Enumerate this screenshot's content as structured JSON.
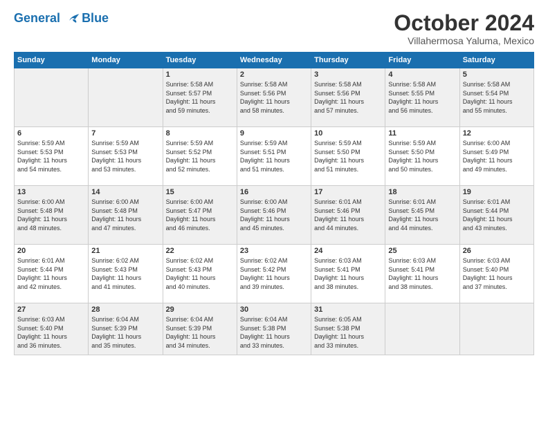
{
  "header": {
    "logo_line1": "General",
    "logo_line2": "Blue",
    "month": "October 2024",
    "location": "Villahermosa Yaluma, Mexico"
  },
  "weekdays": [
    "Sunday",
    "Monday",
    "Tuesday",
    "Wednesday",
    "Thursday",
    "Friday",
    "Saturday"
  ],
  "weeks": [
    [
      {
        "day": "",
        "info": ""
      },
      {
        "day": "",
        "info": ""
      },
      {
        "day": "1",
        "info": "Sunrise: 5:58 AM\nSunset: 5:57 PM\nDaylight: 11 hours\nand 59 minutes."
      },
      {
        "day": "2",
        "info": "Sunrise: 5:58 AM\nSunset: 5:56 PM\nDaylight: 11 hours\nand 58 minutes."
      },
      {
        "day": "3",
        "info": "Sunrise: 5:58 AM\nSunset: 5:56 PM\nDaylight: 11 hours\nand 57 minutes."
      },
      {
        "day": "4",
        "info": "Sunrise: 5:58 AM\nSunset: 5:55 PM\nDaylight: 11 hours\nand 56 minutes."
      },
      {
        "day": "5",
        "info": "Sunrise: 5:58 AM\nSunset: 5:54 PM\nDaylight: 11 hours\nand 55 minutes."
      }
    ],
    [
      {
        "day": "6",
        "info": "Sunrise: 5:59 AM\nSunset: 5:53 PM\nDaylight: 11 hours\nand 54 minutes."
      },
      {
        "day": "7",
        "info": "Sunrise: 5:59 AM\nSunset: 5:53 PM\nDaylight: 11 hours\nand 53 minutes."
      },
      {
        "day": "8",
        "info": "Sunrise: 5:59 AM\nSunset: 5:52 PM\nDaylight: 11 hours\nand 52 minutes."
      },
      {
        "day": "9",
        "info": "Sunrise: 5:59 AM\nSunset: 5:51 PM\nDaylight: 11 hours\nand 51 minutes."
      },
      {
        "day": "10",
        "info": "Sunrise: 5:59 AM\nSunset: 5:50 PM\nDaylight: 11 hours\nand 51 minutes."
      },
      {
        "day": "11",
        "info": "Sunrise: 5:59 AM\nSunset: 5:50 PM\nDaylight: 11 hours\nand 50 minutes."
      },
      {
        "day": "12",
        "info": "Sunrise: 6:00 AM\nSunset: 5:49 PM\nDaylight: 11 hours\nand 49 minutes."
      }
    ],
    [
      {
        "day": "13",
        "info": "Sunrise: 6:00 AM\nSunset: 5:48 PM\nDaylight: 11 hours\nand 48 minutes."
      },
      {
        "day": "14",
        "info": "Sunrise: 6:00 AM\nSunset: 5:48 PM\nDaylight: 11 hours\nand 47 minutes."
      },
      {
        "day": "15",
        "info": "Sunrise: 6:00 AM\nSunset: 5:47 PM\nDaylight: 11 hours\nand 46 minutes."
      },
      {
        "day": "16",
        "info": "Sunrise: 6:00 AM\nSunset: 5:46 PM\nDaylight: 11 hours\nand 45 minutes."
      },
      {
        "day": "17",
        "info": "Sunrise: 6:01 AM\nSunset: 5:46 PM\nDaylight: 11 hours\nand 44 minutes."
      },
      {
        "day": "18",
        "info": "Sunrise: 6:01 AM\nSunset: 5:45 PM\nDaylight: 11 hours\nand 44 minutes."
      },
      {
        "day": "19",
        "info": "Sunrise: 6:01 AM\nSunset: 5:44 PM\nDaylight: 11 hours\nand 43 minutes."
      }
    ],
    [
      {
        "day": "20",
        "info": "Sunrise: 6:01 AM\nSunset: 5:44 PM\nDaylight: 11 hours\nand 42 minutes."
      },
      {
        "day": "21",
        "info": "Sunrise: 6:02 AM\nSunset: 5:43 PM\nDaylight: 11 hours\nand 41 minutes."
      },
      {
        "day": "22",
        "info": "Sunrise: 6:02 AM\nSunset: 5:43 PM\nDaylight: 11 hours\nand 40 minutes."
      },
      {
        "day": "23",
        "info": "Sunrise: 6:02 AM\nSunset: 5:42 PM\nDaylight: 11 hours\nand 39 minutes."
      },
      {
        "day": "24",
        "info": "Sunrise: 6:03 AM\nSunset: 5:41 PM\nDaylight: 11 hours\nand 38 minutes."
      },
      {
        "day": "25",
        "info": "Sunrise: 6:03 AM\nSunset: 5:41 PM\nDaylight: 11 hours\nand 38 minutes."
      },
      {
        "day": "26",
        "info": "Sunrise: 6:03 AM\nSunset: 5:40 PM\nDaylight: 11 hours\nand 37 minutes."
      }
    ],
    [
      {
        "day": "27",
        "info": "Sunrise: 6:03 AM\nSunset: 5:40 PM\nDaylight: 11 hours\nand 36 minutes."
      },
      {
        "day": "28",
        "info": "Sunrise: 6:04 AM\nSunset: 5:39 PM\nDaylight: 11 hours\nand 35 minutes."
      },
      {
        "day": "29",
        "info": "Sunrise: 6:04 AM\nSunset: 5:39 PM\nDaylight: 11 hours\nand 34 minutes."
      },
      {
        "day": "30",
        "info": "Sunrise: 6:04 AM\nSunset: 5:38 PM\nDaylight: 11 hours\nand 33 minutes."
      },
      {
        "day": "31",
        "info": "Sunrise: 6:05 AM\nSunset: 5:38 PM\nDaylight: 11 hours\nand 33 minutes."
      },
      {
        "day": "",
        "info": ""
      },
      {
        "day": "",
        "info": ""
      }
    ]
  ]
}
